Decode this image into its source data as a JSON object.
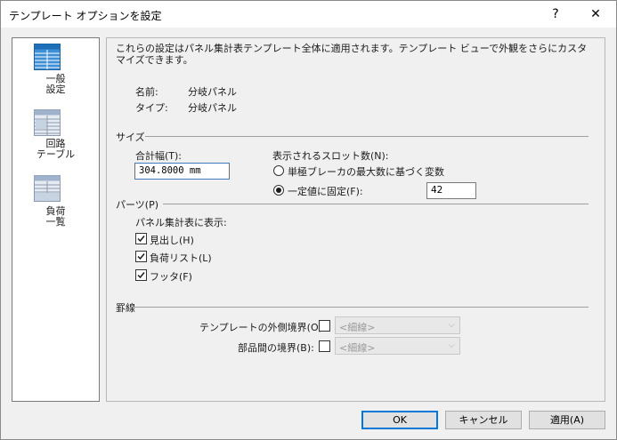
{
  "window": {
    "title": "テンプレート オプションを設定",
    "help_label": "?",
    "close_label": "✕"
  },
  "sidebar": {
    "items": [
      {
        "label": "一般\n設定",
        "icon": "general-settings-icon",
        "selected": true
      },
      {
        "label": "回路\nテーブル",
        "icon": "circuit-table-icon",
        "selected": false
      },
      {
        "label": "負荷\n一覧",
        "icon": "load-list-icon",
        "selected": false
      }
    ]
  },
  "content": {
    "description": "これらの設定はパネル集計表テンプレート全体に適用されます。テンプレート ビューで外観をさらにカスタマイズできます。",
    "name_label": "名前:",
    "name_value": "分岐パネル",
    "type_label": "タイプ:",
    "type_value": "分岐パネル",
    "size_section": "サイズ",
    "total_width_label": "合計幅(T):",
    "total_width_value": "304.8000 mm",
    "slots_label": "表示されるスロット数(N):",
    "radio_variable_label": "単極ブレーカの最大数に基づく変数",
    "radio_fixed_label": "一定値に固定(F):",
    "fixed_value": "42",
    "parts_section": "パーツ(P)",
    "show_in_schedule_label": "パネル集計表に表示:",
    "checkboxes": [
      {
        "label": "見出し(H)",
        "checked": true
      },
      {
        "label": "負荷リスト(L)",
        "checked": true
      },
      {
        "label": "フッタ(F)",
        "checked": true
      }
    ],
    "borders_section": "罫線",
    "outer_border_label": "テンプレートの外側境界(O):",
    "outer_border_value": "<細線>",
    "inner_border_label": "部品間の境界(B):",
    "inner_border_value": "<細線>"
  },
  "buttons": {
    "ok": "OK",
    "cancel": "キャンセル",
    "apply": "適用(A)"
  }
}
